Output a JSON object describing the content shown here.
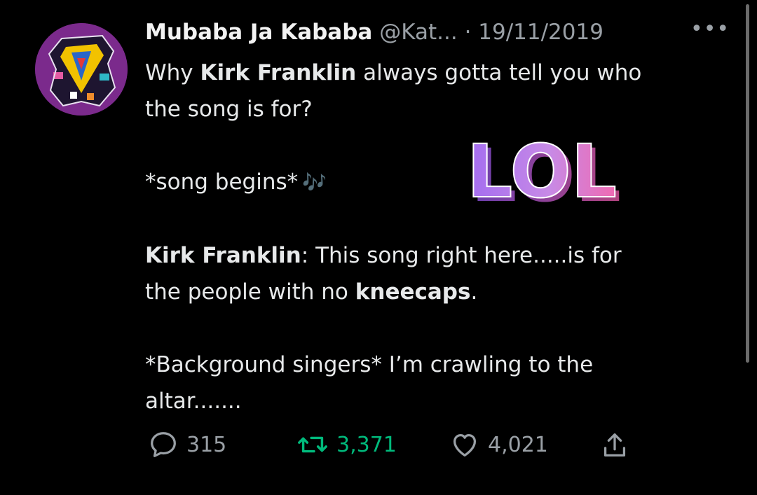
{
  "tweet": {
    "author_name": "Mubaba Ja Kababa",
    "handle": "@Kat...",
    "date": "· 19/11/2019",
    "more_label": "•••",
    "line1_pre": "Why ",
    "line1_bold": "Kirk Franklin",
    "line1_post": " always gotta tell you who",
    "line2": "the song is for?",
    "song_begins": "*song begins*",
    "notes": "🎶",
    "sticker_text": "LOL",
    "kirk_label": "Kirk Franklin",
    "kirk_speech": ": This song right here.....is for",
    "people_pre": "the people with no ",
    "people_bold": "kneecaps",
    "people_post": ".",
    "background_line": "*Background singers* I’m crawling to the",
    "altar_line": "altar......."
  },
  "actions": {
    "replies": "315",
    "retweets": "3,371",
    "likes": "4,021"
  },
  "colors": {
    "background": "#000000",
    "retweet_green": "#00ba7c",
    "muted": "#9aa0a6",
    "avatar_purple": "#7b2a8c"
  },
  "icons": [
    "reply-icon",
    "retweet-icon",
    "heart-icon",
    "share-icon",
    "music-notes-icon"
  ]
}
